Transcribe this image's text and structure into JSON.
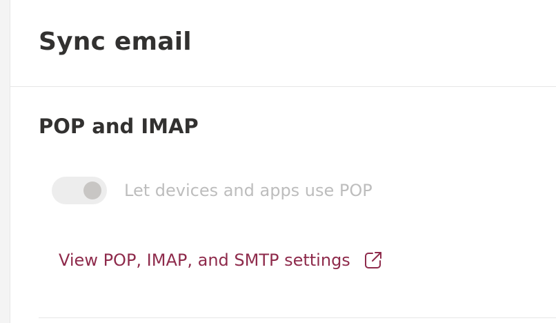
{
  "header": {
    "title": "Sync email"
  },
  "pop_imap": {
    "section_title": "POP and IMAP",
    "pop_toggle": {
      "label": "Let devices and apps use POP",
      "enabled": false,
      "state": "disabled"
    },
    "settings_link": {
      "label": "View POP, IMAP, and SMTP settings",
      "icon": "external-link-icon"
    }
  },
  "colors": {
    "link": "#8e2a4b",
    "heading": "#323130",
    "disabled_text": "#bdbdbd",
    "toggle_track": "#ededed",
    "toggle_knob": "#c8c6c4",
    "divider": "#e6e6e6"
  }
}
